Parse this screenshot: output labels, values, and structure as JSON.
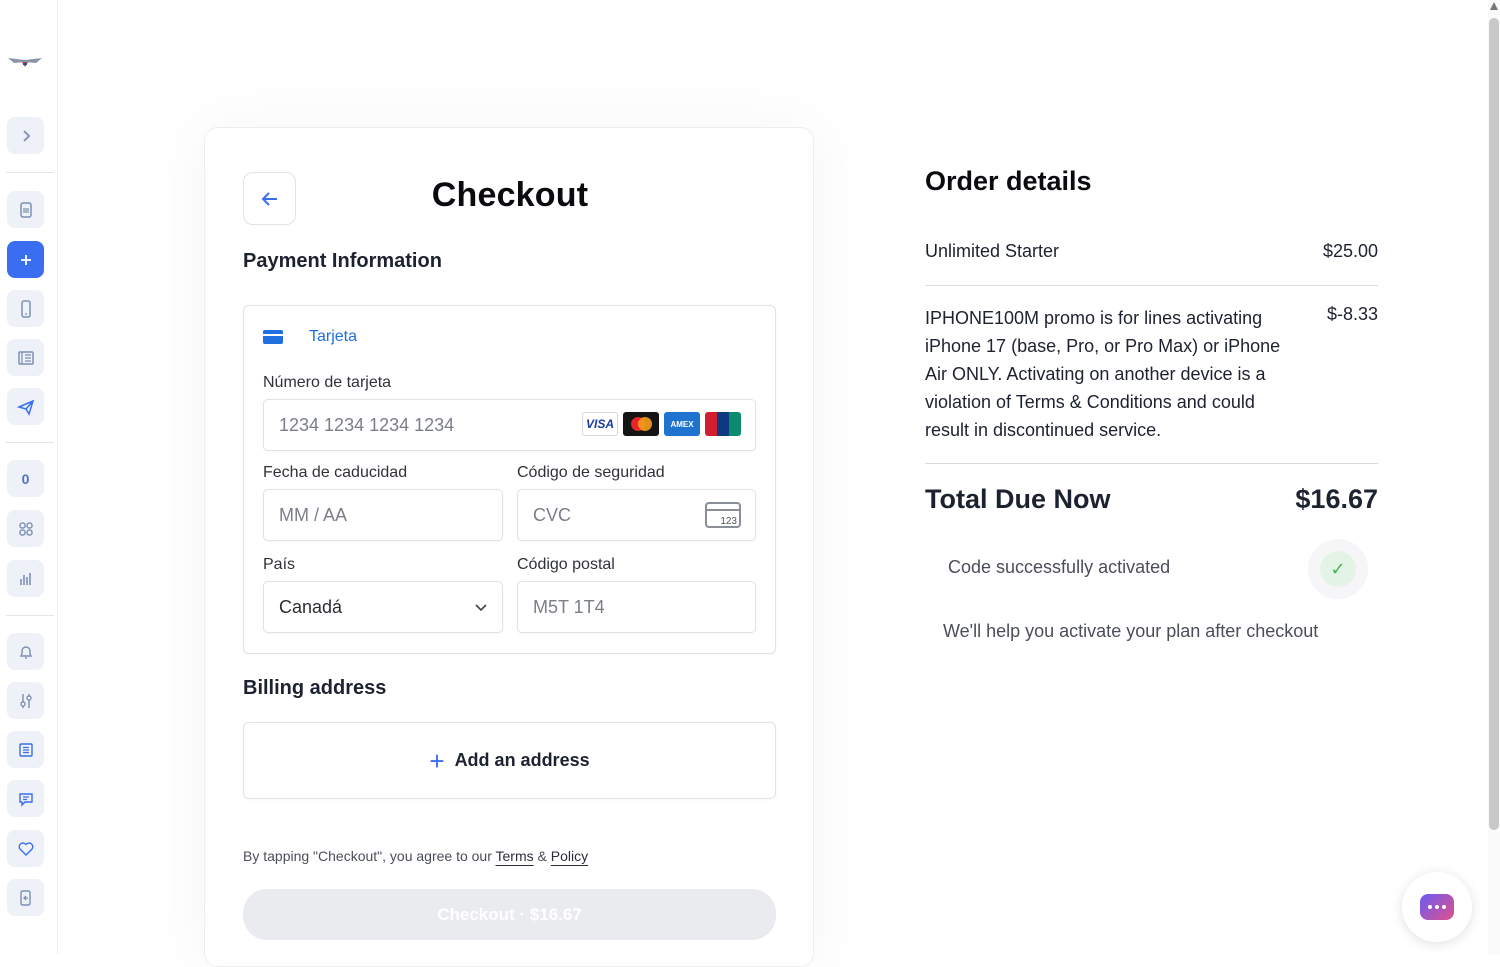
{
  "sidebar": {
    "badge_count": "0"
  },
  "checkout": {
    "title": "Checkout",
    "payment_heading": "Payment Information",
    "tab_label": "Tarjeta",
    "card_number_label": "Número de tarjeta",
    "card_number_placeholder": "1234 1234 1234 1234",
    "expiry_label": "Fecha de caducidad",
    "expiry_placeholder": "MM / AA",
    "cvc_label": "Código de seguridad",
    "cvc_placeholder": "CVC",
    "cvc_icon_text": "123",
    "country_label": "País",
    "country_value": "Canadá",
    "postal_label": "Código postal",
    "postal_placeholder": "M5T 1T4",
    "card_brands": [
      "VISA",
      "Mastercard",
      "AMEX",
      "UnionPay"
    ],
    "billing_heading": "Billing address",
    "add_address_label": "Add an address",
    "terms_prefix": "By tapping \"Checkout\", you agree to our",
    "terms_link": "Terms",
    "terms_amp": "&",
    "policy_link": "Policy",
    "checkout_button": "Checkout · $16.67"
  },
  "order": {
    "title": "Order details",
    "items": [
      {
        "name": "Unlimited Starter",
        "price": "$25.00"
      },
      {
        "name": "IPHONE100M promo is for lines activating iPhone 17 (base, Pro, or Pro Max) or iPhone Air ONLY. Activating on another device is a violation of Terms & Conditions and could result in discontinued service.",
        "price": "$-8.33"
      }
    ],
    "total_label": "Total Due Now",
    "total_value": "$16.67",
    "code_status": "Code successfully activated",
    "help_text": "We'll help you activate your plan after checkout"
  },
  "colors": {
    "accent": "#3a6df0",
    "link_blue": "#1f6fe0",
    "success": "#47b25a"
  }
}
